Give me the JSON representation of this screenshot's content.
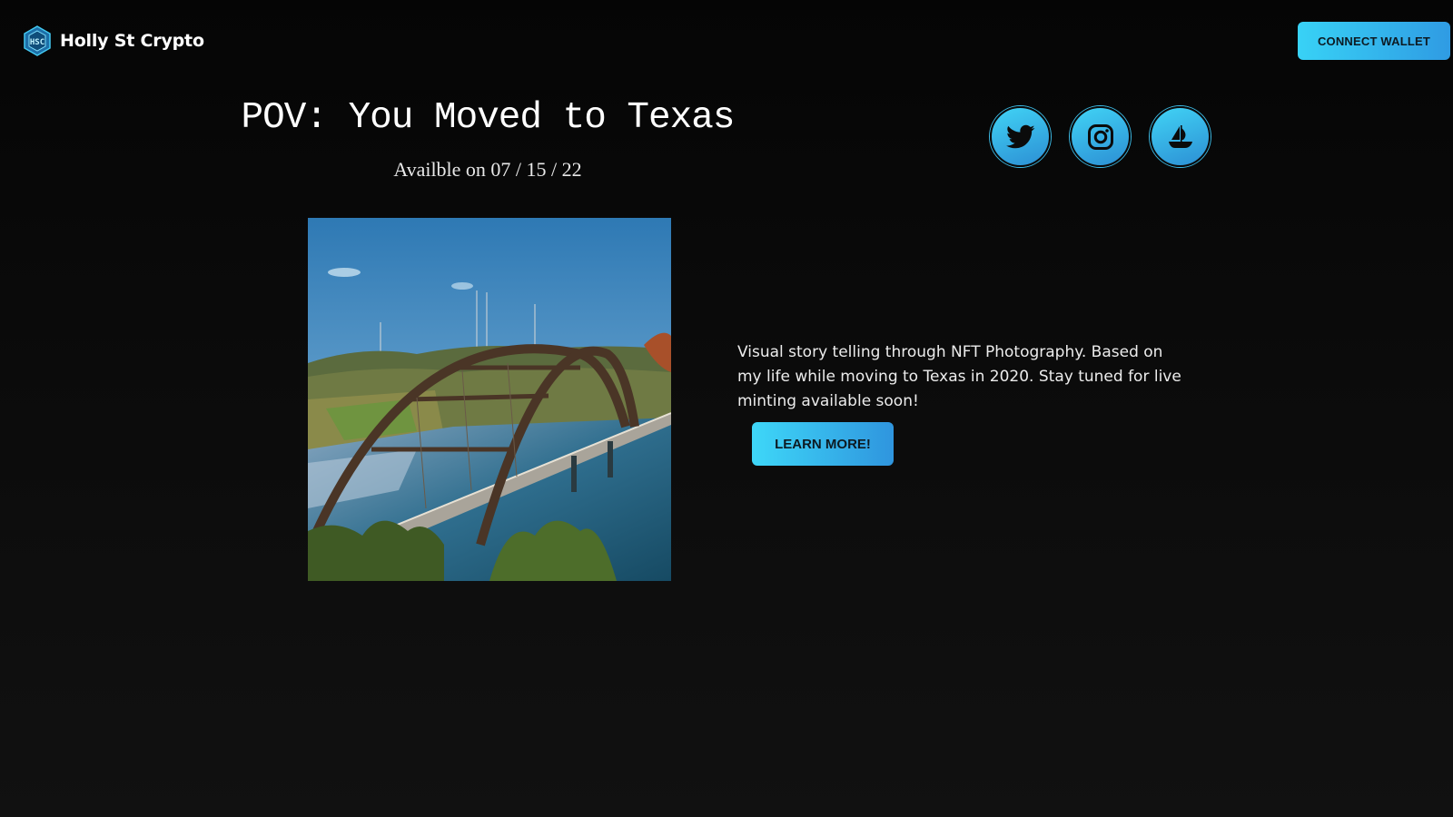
{
  "header": {
    "brand_name": "Holly St Crypto",
    "logo_icon": "hsc-logo-icon",
    "connect_label": "CONNECT WALLET"
  },
  "hero": {
    "title": "POV: You Moved to Texas",
    "subtitle": "Availble on 07 / 15 / 22"
  },
  "social": {
    "items": [
      {
        "icon": "twitter-icon"
      },
      {
        "icon": "instagram-icon"
      },
      {
        "icon": "opensea-icon"
      }
    ]
  },
  "main": {
    "image_subject": "pennybacker-bridge-photo",
    "description": "Visual story telling through NFT Photography. Based on my life while moving to Texas in 2020. Stay tuned for live minting available soon!",
    "learn_more_label": "LEARN MORE!"
  },
  "colors": {
    "accent_start": "#38d2f6",
    "accent_end": "#2f9be3",
    "background": "#0b0b0b",
    "text": "#ffffff"
  }
}
